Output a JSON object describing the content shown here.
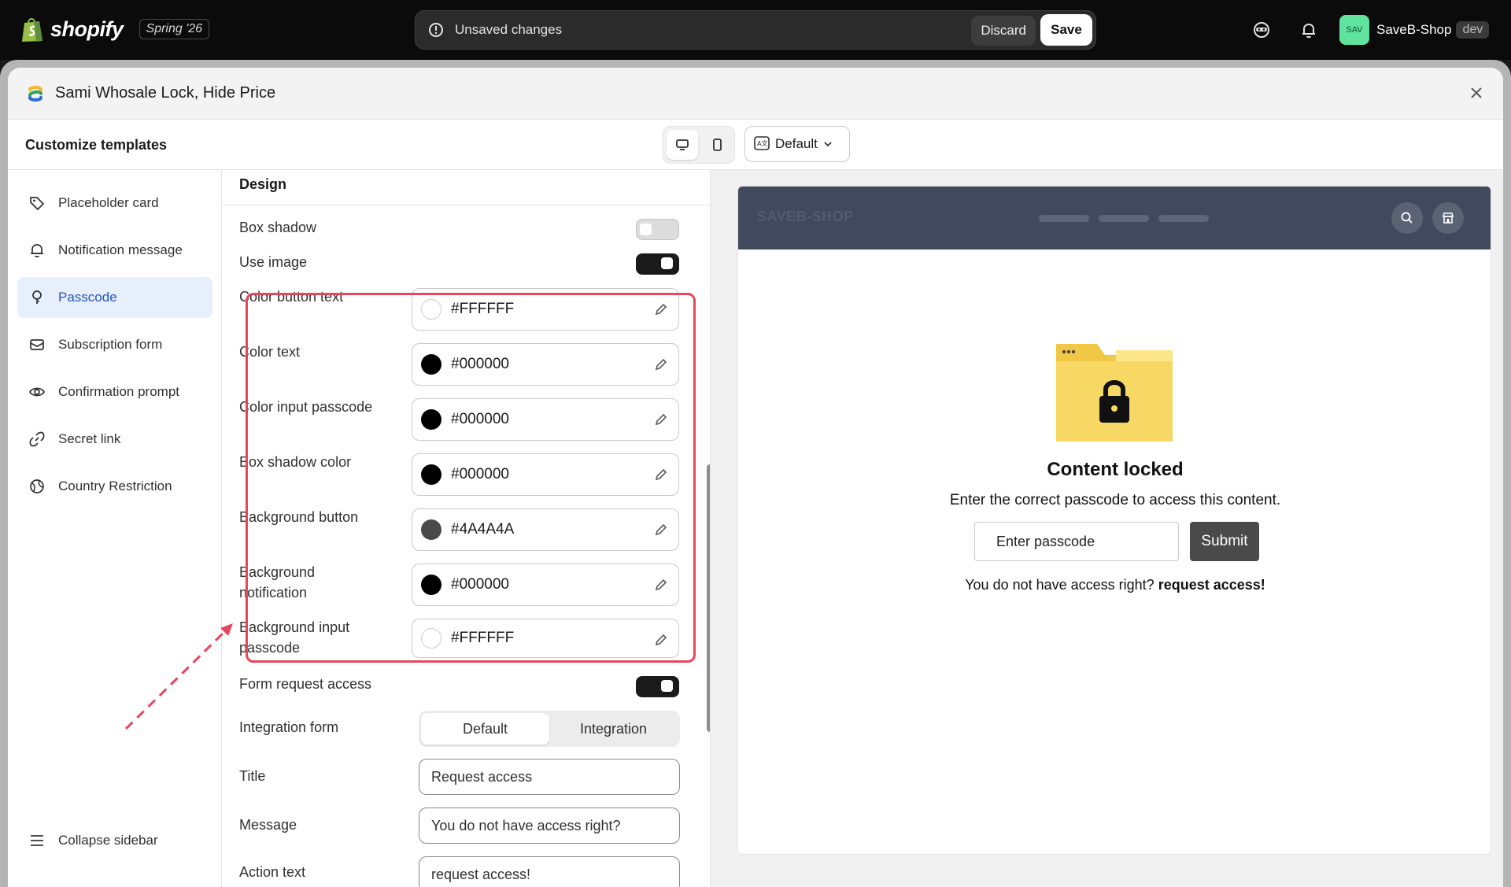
{
  "topbar": {
    "brand": "shopify",
    "edition": "Spring '26",
    "unsaved_text": "Unsaved changes",
    "discard_label": "Discard",
    "save_label": "Save",
    "store_avatar": "SAV",
    "store_name": "SaveB-Shop",
    "store_tag": "dev"
  },
  "app": {
    "title": "Sami Whosale Lock, Hide Price",
    "subheader_title": "Customize templates",
    "language_label": "Default"
  },
  "sidebar": {
    "items": [
      {
        "label": "Placeholder card",
        "icon": "tag-icon"
      },
      {
        "label": "Notification message",
        "icon": "bell-icon"
      },
      {
        "label": "Passcode",
        "icon": "key-icon"
      },
      {
        "label": "Subscription form",
        "icon": "email-icon"
      },
      {
        "label": "Confirmation prompt",
        "icon": "eye-icon"
      },
      {
        "label": "Secret link",
        "icon": "link-icon"
      },
      {
        "label": "Country Restriction",
        "icon": "globe-icon"
      }
    ],
    "collapse_label": "Collapse sidebar",
    "active_index": 2
  },
  "settings": {
    "section_title": "Design",
    "box_shadow_label": "Box shadow",
    "box_shadow_on": false,
    "use_image_label": "Use image",
    "use_image_on": true,
    "colors": [
      {
        "label": "Color button text",
        "value": "#FFFFFF"
      },
      {
        "label": "Color text",
        "value": "#000000"
      },
      {
        "label": "Color input passcode",
        "value": "#000000"
      },
      {
        "label": "Box shadow color",
        "value": "#000000"
      },
      {
        "label": "Background button",
        "value": "#4A4A4A"
      },
      {
        "label": "Background notification",
        "value": "#000000"
      },
      {
        "label": "Background input passcode",
        "value": "#FFFFFF"
      }
    ],
    "form_request_label": "Form request access",
    "form_request_on": true,
    "integration_label": "Integration form",
    "integration_options": [
      "Default",
      "Integration"
    ],
    "integration_selected": "Default",
    "title_label": "Title",
    "title_value": "Request access",
    "message_label": "Message",
    "message_value": "You do not have access right?",
    "action_label": "Action text",
    "action_value": "request access!"
  },
  "preview": {
    "store_brand": "SAVEB-SHOP",
    "locked_title": "Content locked",
    "locked_message": "Enter the correct passcode to access this content.",
    "passcode_placeholder": "Enter passcode",
    "submit_label": "Submit",
    "access_prefix": "You do not have access right?",
    "access_link": "request access!"
  },
  "colors": {
    "accent": "#2456b5",
    "highlight": "#e8465d",
    "store_bar": "#414a5c",
    "folder": "#f5d55a"
  }
}
